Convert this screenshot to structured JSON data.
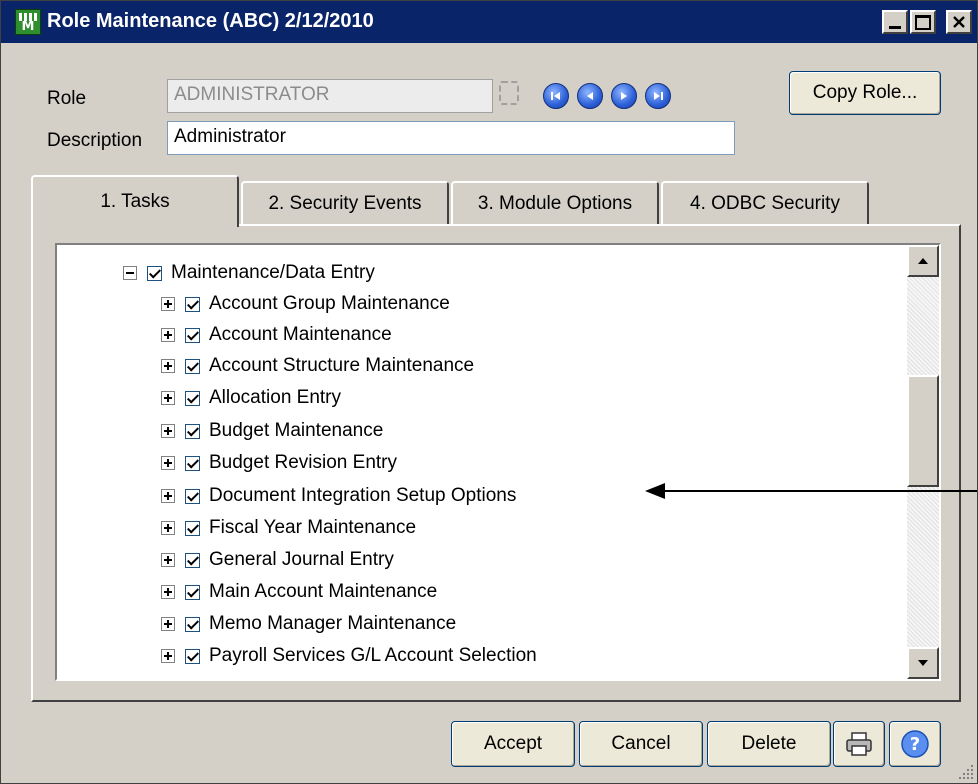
{
  "window": {
    "title": "Role Maintenance (ABC) 2/12/2010",
    "app_icon_label": "M"
  },
  "form": {
    "role_label": "Role",
    "role_value": "ADMINISTRATOR",
    "description_label": "Description",
    "description_value": "Administrator",
    "copy_role_button": "Copy Role..."
  },
  "tabs": [
    {
      "label": "1. Tasks",
      "active": true
    },
    {
      "label": "2. Security Events",
      "active": false
    },
    {
      "label": "3. Module Options",
      "active": false
    },
    {
      "label": "4. ODBC Security",
      "active": false
    }
  ],
  "tree": {
    "parent": {
      "label": "Maintenance/Data Entry",
      "expanded": true,
      "checked": true
    },
    "children": [
      {
        "label": "Account Group Maintenance",
        "checked": true
      },
      {
        "label": "Account Maintenance",
        "checked": true
      },
      {
        "label": "Account Structure Maintenance",
        "checked": true
      },
      {
        "label": "Allocation Entry",
        "checked": true
      },
      {
        "label": "Budget Maintenance",
        "checked": true
      },
      {
        "label": "Budget Revision Entry",
        "checked": true
      },
      {
        "label": "Document Integration Setup Options",
        "checked": true
      },
      {
        "label": "Fiscal Year Maintenance",
        "checked": true
      },
      {
        "label": "General Journal Entry",
        "checked": true
      },
      {
        "label": "Main Account Maintenance",
        "checked": true
      },
      {
        "label": "Memo Manager Maintenance",
        "checked": true
      },
      {
        "label": "Payroll Services G/L Account Selection",
        "checked": true
      }
    ]
  },
  "footer": {
    "accept_button": "Accept",
    "cancel_button": "Cancel",
    "delete_button": "Delete"
  },
  "colors": {
    "titlebar": "#0a246a",
    "window_face": "#d4d0c8",
    "nav_button": "#2c5fd8"
  }
}
